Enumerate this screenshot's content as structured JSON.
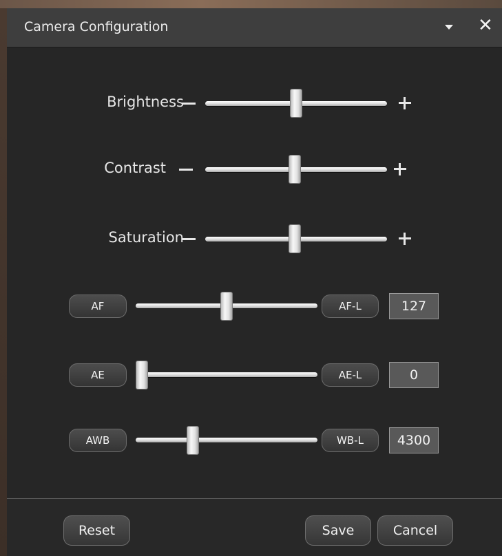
{
  "window": {
    "title": "Camera Configuration",
    "dropdown_icon": "chevron-down-icon",
    "close_icon": "close-icon",
    "close_glyph": "✕"
  },
  "sliders": [
    {
      "label": "Brightness",
      "value_fraction": 0.5
    },
    {
      "label": "Contrast",
      "value_fraction": 0.49
    },
    {
      "label": "Saturation",
      "value_fraction": 0.49
    }
  ],
  "controls": [
    {
      "mode_button": "AF",
      "lock_button": "AF-L",
      "value": "127",
      "value_fraction": 0.5
    },
    {
      "mode_button": "AE",
      "lock_button": "AE-L",
      "value": "0",
      "value_fraction": 0.0
    },
    {
      "mode_button": "AWB",
      "lock_button": "WB-L",
      "value": "4300",
      "value_fraction": 0.3
    }
  ],
  "footer": {
    "reset_label": "Reset",
    "save_label": "Save",
    "cancel_label": "Cancel"
  },
  "colors": {
    "dialog_bg": "#262626",
    "titlebar_bg": "#3e3e3e",
    "text": "#ececec"
  }
}
